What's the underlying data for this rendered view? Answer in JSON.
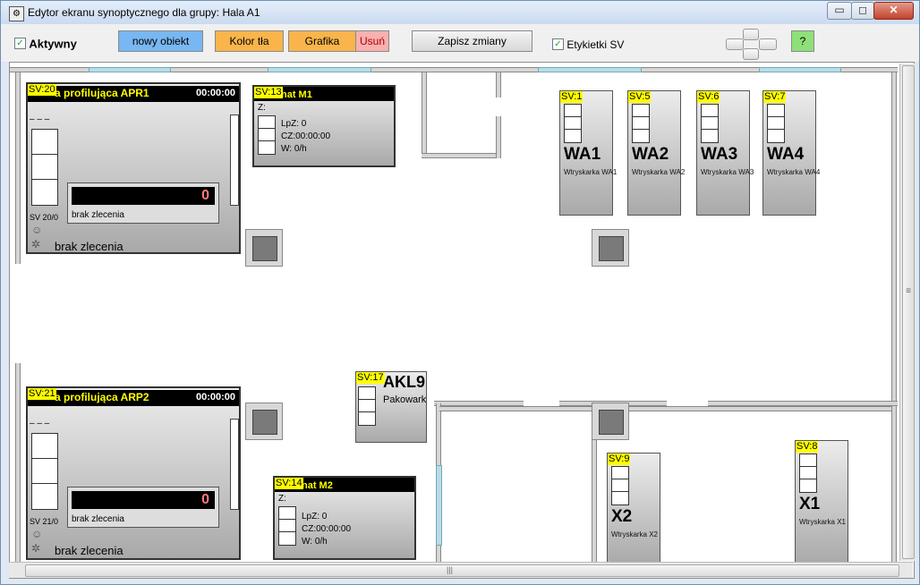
{
  "window": {
    "title": "Edytor ekranu synoptycznego dla grupy: Hala A1",
    "min_label": "▭",
    "max_label": "◻",
    "close_label": "✕"
  },
  "toolbar": {
    "active_label": "Aktywny",
    "new_object": "nowy obiekt",
    "bg_color": "Kolor tła",
    "graphics": "Grafika",
    "delete": "Usuń",
    "save": "Zapisz zmiany",
    "labels_sv": "Etykietki SV",
    "help": "?"
  },
  "colors": {
    "new_object_bg": "#78b7f2",
    "orange": "#f9b54b",
    "delete_bg": "#f8b0b0",
    "help_bg": "#8ee07a",
    "sv_yellow": "#ffff00"
  },
  "lines": [
    {
      "sv": "SV:20",
      "name": "Linia profilująca APR1",
      "name_visible": "a profilująca APR1",
      "time": "00:00:00",
      "dash": "– – –",
      "counter": "0",
      "order_label": "brak zlecenia",
      "sv_small": "SV 20/0",
      "order_status": "brak zlecenia"
    },
    {
      "sv": "SV:21",
      "name": "Linia profilująca ARP2",
      "name_visible": "a profilująca ARP2",
      "time": "00:00:00",
      "dash": "– – –",
      "counter": "0",
      "order_label": "brak zlecenia",
      "sv_small": "SV 21/0",
      "order_status": "brak zlecenia"
    }
  ],
  "automats": [
    {
      "sv": "SV:13",
      "title": "nat M1",
      "z": "Z:",
      "lpz": "LpZ: 0",
      "cz": "CZ:00:00:00",
      "w": "W: 0/h"
    },
    {
      "sv": "SV:14",
      "title": "nat M2",
      "z": "Z:",
      "lpz": "LpZ: 0",
      "cz": "CZ:00:00:00",
      "w": "W: 0/h"
    }
  ],
  "machines": [
    {
      "sv": "SV:1",
      "name": "WA1",
      "desc": "Wtryskarka WA1"
    },
    {
      "sv": "SV:5",
      "name": "WA2",
      "desc": "Wtryskarka WA2"
    },
    {
      "sv": "SV:6",
      "name": "WA3",
      "desc": "Wtryskarka WA3"
    },
    {
      "sv": "SV:7",
      "name": "WA4",
      "desc": "Wtryskarka WA4"
    },
    {
      "sv": "SV:9",
      "name": "X2",
      "desc": "Wtryskarka X2"
    },
    {
      "sv": "SV:8",
      "name": "X1",
      "desc": "Wtryskarka X1"
    }
  ],
  "packer": {
    "sv": "SV:17",
    "name": "AKL9",
    "desc": "Pakowark"
  },
  "scroll": {
    "h_grip": "|||",
    "v_grip": "≡"
  }
}
